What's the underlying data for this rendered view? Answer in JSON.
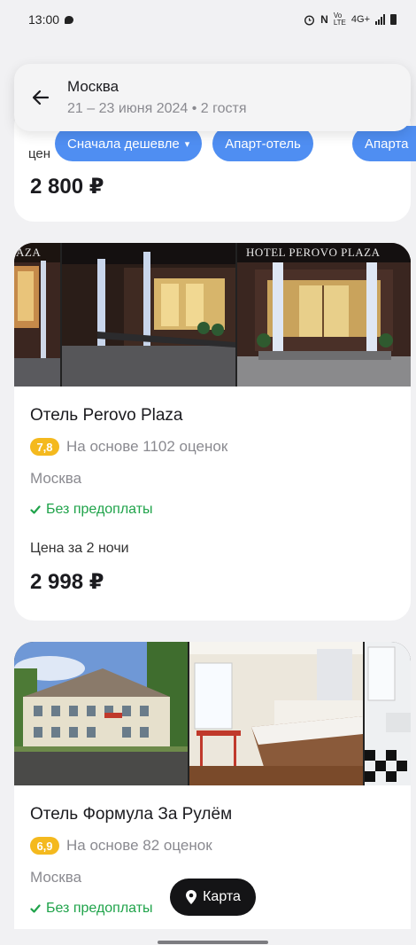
{
  "status_bar": {
    "time": "13:00",
    "network": "4G+"
  },
  "search": {
    "city": "Москва",
    "details": "21 – 23 июня 2024 • 2 гостя"
  },
  "filters": {
    "partial_label": "цен",
    "chips": [
      "Сначала дешевле",
      "Апарт-отель",
      "Апарта"
    ]
  },
  "listings": [
    {
      "price": "2 800 ₽"
    },
    {
      "name": "Отель Perovo Plaza",
      "rating": "7,8",
      "rating_text": "На основе 1102 оценок",
      "city": "Москва",
      "prepayment": "Без предоплаты",
      "nights_label": "Цена за 2 ночи",
      "price": "2 998 ₽",
      "photo_sign": "HOTEL PEROVO PLAZA",
      "photo_sign_short": "AZA"
    },
    {
      "name": "Отель Формула За Рулём",
      "rating": "6,9",
      "rating_text": "На основе 82 оценок",
      "city": "Москва",
      "prepayment": "Без предоплаты"
    }
  ],
  "map_button": {
    "label": "Карта"
  },
  "colors": {
    "accent": "#4f8ef2",
    "rating": "#f4b91e",
    "success": "#1fa34a",
    "dark_button": "#141416"
  }
}
